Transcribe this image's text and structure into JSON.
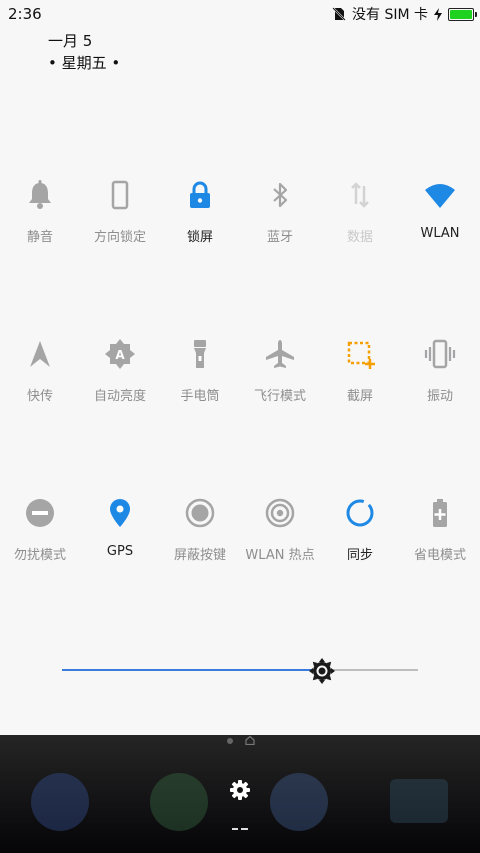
{
  "status_bar": {
    "time": "2:36",
    "carrier": "没有 SIM 卡",
    "icons": [
      "no-sim-icon",
      "charging-icon",
      "battery-icon"
    ],
    "battery_level": 1.0,
    "battery_color": "#1fd21f"
  },
  "header": {
    "date": "一月 5",
    "weekday": "• 星期五 •"
  },
  "accent_colors": {
    "blue": "#1e88e5",
    "orange": "#f5a000",
    "gray": "#a5a5a5"
  },
  "tiles": [
    {
      "label": "静音",
      "icon": "bell-icon",
      "state": "off"
    },
    {
      "label": "方向锁定",
      "icon": "phone-rotate-icon",
      "state": "off"
    },
    {
      "label": "锁屏",
      "icon": "lock-icon",
      "state": "on"
    },
    {
      "label": "蓝牙",
      "icon": "bluetooth-icon",
      "state": "off"
    },
    {
      "label": "数据",
      "icon": "data-icon",
      "state": "disabled"
    },
    {
      "label": "WLAN",
      "icon": "wifi-icon",
      "state": "on"
    },
    {
      "label": "快传",
      "icon": "fast-transfer-icon",
      "state": "off"
    },
    {
      "label": "自动亮度",
      "icon": "auto-brightness-icon",
      "state": "off"
    },
    {
      "label": "手电筒",
      "icon": "flashlight-icon",
      "state": "off"
    },
    {
      "label": "飞行模式",
      "icon": "airplane-icon",
      "state": "off"
    },
    {
      "label": "截屏",
      "icon": "screenshot-icon",
      "state": "accent"
    },
    {
      "label": "振动",
      "icon": "vibrate-icon",
      "state": "off"
    },
    {
      "label": "勿扰模式",
      "icon": "do-not-disturb-icon",
      "state": "off"
    },
    {
      "label": "GPS",
      "icon": "location-icon",
      "state": "on"
    },
    {
      "label": "屏蔽按键",
      "icon": "block-keys-icon",
      "state": "off"
    },
    {
      "label": "WLAN 热点",
      "icon": "hotspot-icon",
      "state": "off"
    },
    {
      "label": "同步",
      "icon": "sync-icon",
      "state": "on"
    },
    {
      "label": "省电模式",
      "icon": "battery-saver-icon",
      "state": "off"
    }
  ],
  "brightness": {
    "level": 0.73
  },
  "dock": {
    "icons": [
      "phone-icon",
      "browser-icon",
      "settings-gear-icon",
      "messages-icon",
      "camera-icon"
    ]
  }
}
